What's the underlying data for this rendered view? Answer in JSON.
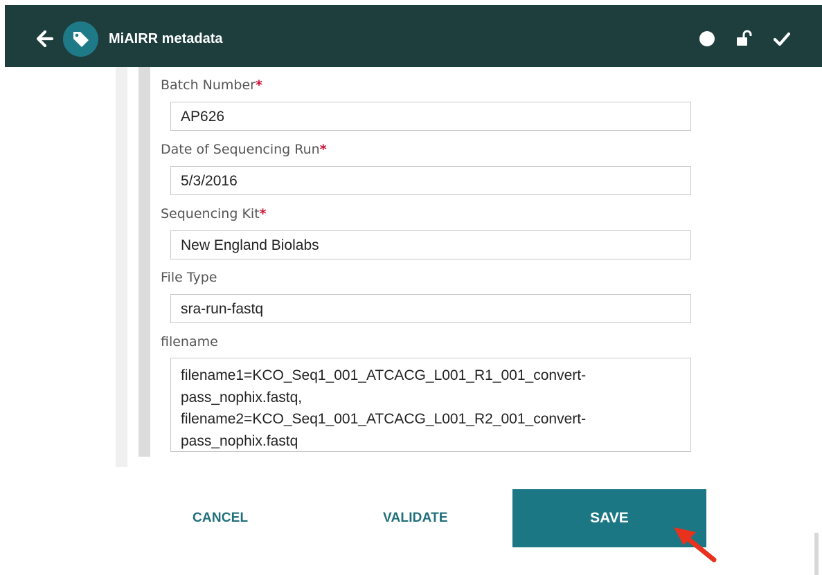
{
  "header": {
    "title": "MiAIRR metadata",
    "background": "#1e3d3d",
    "icons": [
      "back-arrow-icon",
      "tag-icon",
      "status-dot-icon",
      "unlock-icon",
      "check-icon"
    ]
  },
  "form": {
    "fields": [
      {
        "label": "Batch Number",
        "required": true,
        "value": "AP626"
      },
      {
        "label": "Date of Sequencing Run",
        "required": true,
        "value": "5/3/2016"
      },
      {
        "label": "Sequencing Kit",
        "required": true,
        "value": "New England Biolabs"
      },
      {
        "label": "File Type",
        "required": false,
        "value": "sra-run-fastq"
      },
      {
        "label": "filename",
        "required": false,
        "value": "filename1=KCO_Seq1_001_ATCACG_L001_R1_001_convert-\npass_nophix.fastq,\nfilename2=KCO_Seq1_001_ATCACG_L001_R2_001_convert-\npass_nophix.fastq"
      }
    ],
    "required_marker": "*"
  },
  "actions": {
    "cancel_label": "CANCEL",
    "validate_label": "VALIDATE",
    "save_label": "SAVE"
  },
  "colors": {
    "accent": "#1b7784",
    "required": "#cc1133",
    "annotation_arrow": "#e8321e"
  }
}
